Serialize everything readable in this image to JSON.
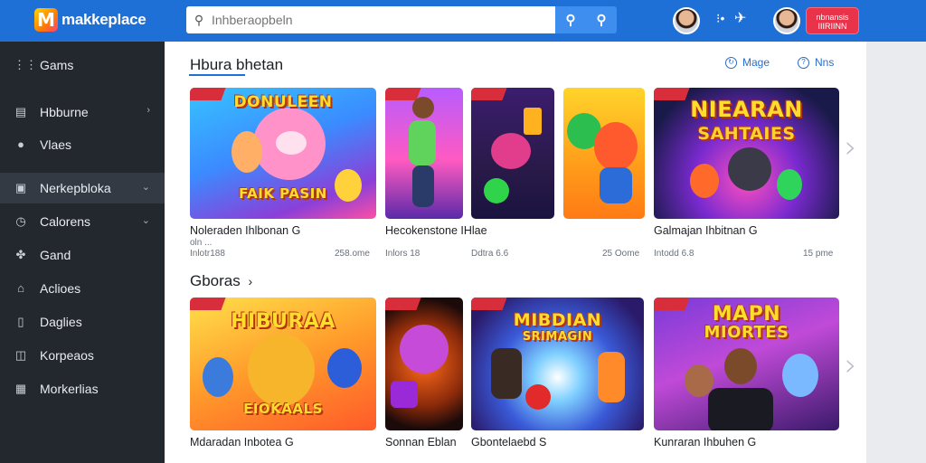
{
  "app": {
    "logo_mark": "M",
    "logo_text": "makkeplace"
  },
  "search": {
    "placeholder": "Inhberaopbeln"
  },
  "header": {
    "tool_label": "⁝•",
    "action_button": "nbnansis IIIRIINN"
  },
  "sidebar": {
    "items": [
      {
        "label": "Gams",
        "icon": "grid-icon"
      },
      {
        "label": "Hbburne",
        "icon": "news-icon",
        "chevron": "›"
      },
      {
        "label": "Vlaes",
        "icon": "users-icon"
      },
      {
        "label": "Nerkepbloka",
        "icon": "store-icon",
        "chevron": "⌄",
        "active": true
      },
      {
        "label": "Calorens",
        "icon": "clock-icon",
        "chevron": "⌄"
      },
      {
        "label": "Gand",
        "icon": "puzzle-icon"
      },
      {
        "label": "Aclioes",
        "icon": "lock-icon"
      },
      {
        "label": "Daglies",
        "icon": "document-icon"
      },
      {
        "label": "Korpeaos",
        "icon": "bag-icon"
      },
      {
        "label": "Morkerlias",
        "icon": "window-icon"
      }
    ]
  },
  "section1": {
    "title": "Hbura bhetan",
    "actions": [
      {
        "label": "Mage",
        "icon": "refresh-icon"
      },
      {
        "label": "Nns",
        "icon": "help-icon"
      }
    ],
    "cards": [
      {
        "thumb_text": "DONULEEN",
        "thumb_sub": "FAIK PASIN",
        "title": "Noleraden Ihlbonan G",
        "meta_left": "oln ...",
        "meta_left2": "Inlotr188",
        "meta_right": "258.ome"
      },
      {
        "thumb_text": "",
        "thumb_sub": "",
        "title": "Hecokenstone IHlae",
        "meta_left": "Inlors 18",
        "meta_left2": "",
        "meta_right": ""
      },
      {
        "thumb_text": "",
        "thumb_sub": "",
        "title": "",
        "meta_left": "Ddtra 6.6",
        "meta_left2": "",
        "meta_right": "25 Oome"
      },
      {
        "thumb_text": "",
        "thumb_sub": "",
        "title": "",
        "meta_left": "",
        "meta_left2": "",
        "meta_right": ""
      },
      {
        "thumb_text": "NIEARAN",
        "thumb_sub": "SAHTAIES",
        "title": "Galmajan Ihbitnan G",
        "meta_left": "Intodd 6.8",
        "meta_left2": "",
        "meta_right": "15 pme"
      }
    ]
  },
  "section2": {
    "title": "Gboras",
    "chevron": "›",
    "cards": [
      {
        "thumb_text": "HIBURAA",
        "thumb_sub": "EIOKAALS",
        "title": "Mdaradan Inbotea G"
      },
      {
        "thumb_text": "",
        "thumb_sub": "",
        "title": "Sonnan Eblan"
      },
      {
        "thumb_text": "MIBDIAN",
        "thumb_sub": "SRIMAGIN",
        "title": "Gbontelaebd S"
      },
      {
        "thumb_text": "MAPN",
        "thumb_sub": "MIORTES",
        "title": "Kunraran Ihbuhen G"
      }
    ]
  },
  "pager": {
    "next": "›"
  },
  "colors": {
    "topbar": "#1e6fd6",
    "sidebar": "#23272e",
    "accent_red": "#e8334a"
  }
}
